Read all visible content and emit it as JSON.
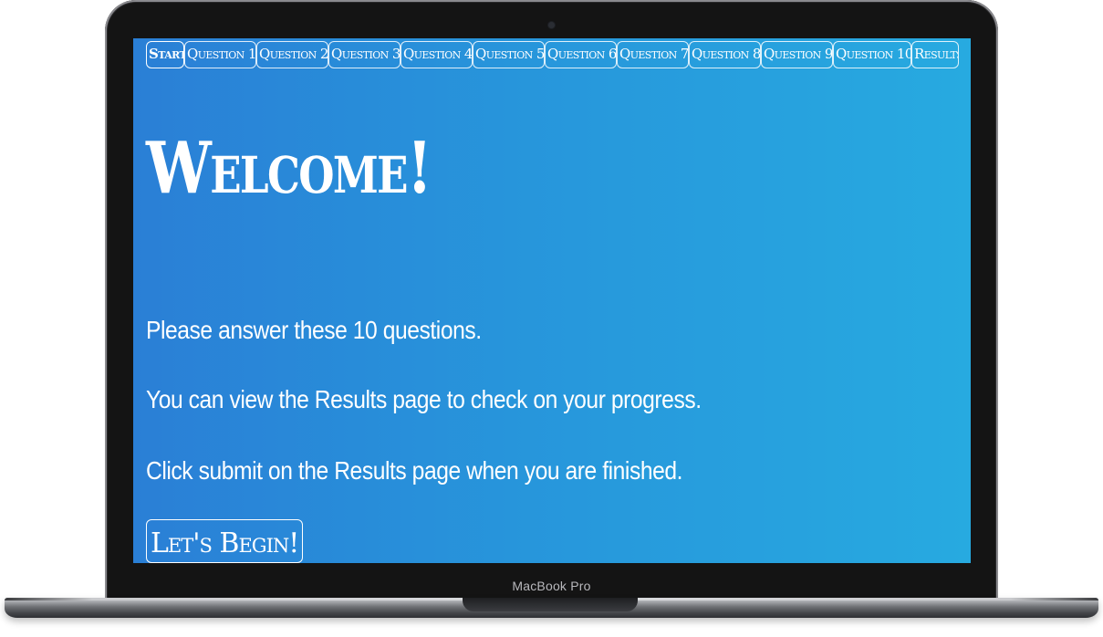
{
  "device": {
    "label": "MacBook Pro"
  },
  "app": {
    "nav": {
      "tabs": [
        {
          "label": "Start",
          "active": true
        },
        {
          "label": "Question 1",
          "active": false
        },
        {
          "label": "Question 2",
          "active": false
        },
        {
          "label": "Question 3",
          "active": false
        },
        {
          "label": "Question 4",
          "active": false
        },
        {
          "label": "Question 5",
          "active": false
        },
        {
          "label": "Question 6",
          "active": false
        },
        {
          "label": "Question 7",
          "active": false
        },
        {
          "label": "Question 8",
          "active": false
        },
        {
          "label": "Question 9",
          "active": false
        },
        {
          "label": "Question 10",
          "active": false
        },
        {
          "label": "Results",
          "active": false
        }
      ]
    },
    "main": {
      "heading": "Welcome!",
      "paragraphs": [
        "Please answer these 10 questions.",
        "You can view the Results page to check on your progress.",
        "Click submit on the Results page when you are finished."
      ],
      "begin_label": "Let's Begin!"
    },
    "colors": {
      "gradient_start": "#2a7fd6",
      "gradient_end": "#27aae0",
      "text": "#ffffff"
    }
  }
}
